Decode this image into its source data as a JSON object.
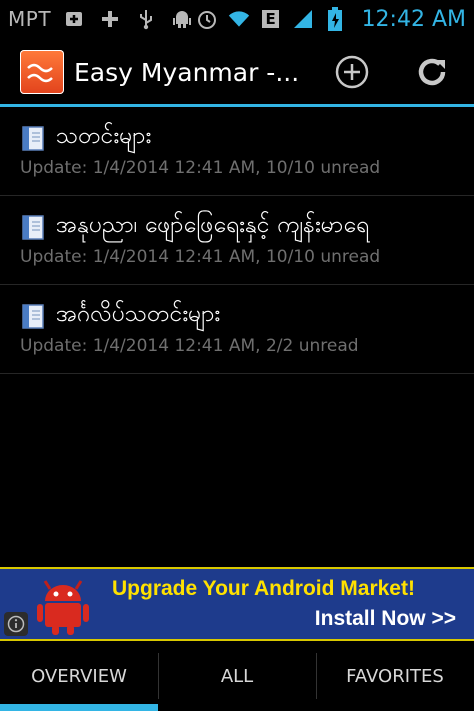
{
  "status_bar": {
    "carrier": "MPT",
    "network_badge": "E",
    "time": "12:42 AM"
  },
  "action_bar": {
    "title": "Easy Myanmar -...",
    "logo_icon": "app-logo-icon",
    "add_icon": "add-circle-icon",
    "refresh_icon": "refresh-icon"
  },
  "feeds": [
    {
      "title": "သတင်းများ",
      "update": "Update: 1/4/2014 12:41 AM, 10/10 unread"
    },
    {
      "title": "အနုပညာ၊ ဖျော်ဖြေရေးနှင့် ကျန်းမာရေ",
      "update": "Update: 1/4/2014 12:41 AM, 10/10 unread"
    },
    {
      "title": "အင်္ဂလိပ်သတင်းများ",
      "update": "Update: 1/4/2014 12:41 AM, 2/2 unread"
    }
  ],
  "ad": {
    "headline": "Upgrade Your Android Market!",
    "cta": "Install Now >>"
  },
  "tabs": [
    {
      "label": "OVERVIEW",
      "active": true
    },
    {
      "label": "ALL",
      "active": false
    },
    {
      "label": "FAVORITES",
      "active": false
    }
  ],
  "colors": {
    "accent": "#33b5e5",
    "ad_background": "#1e3b8c",
    "ad_headline": "#ffe100"
  }
}
